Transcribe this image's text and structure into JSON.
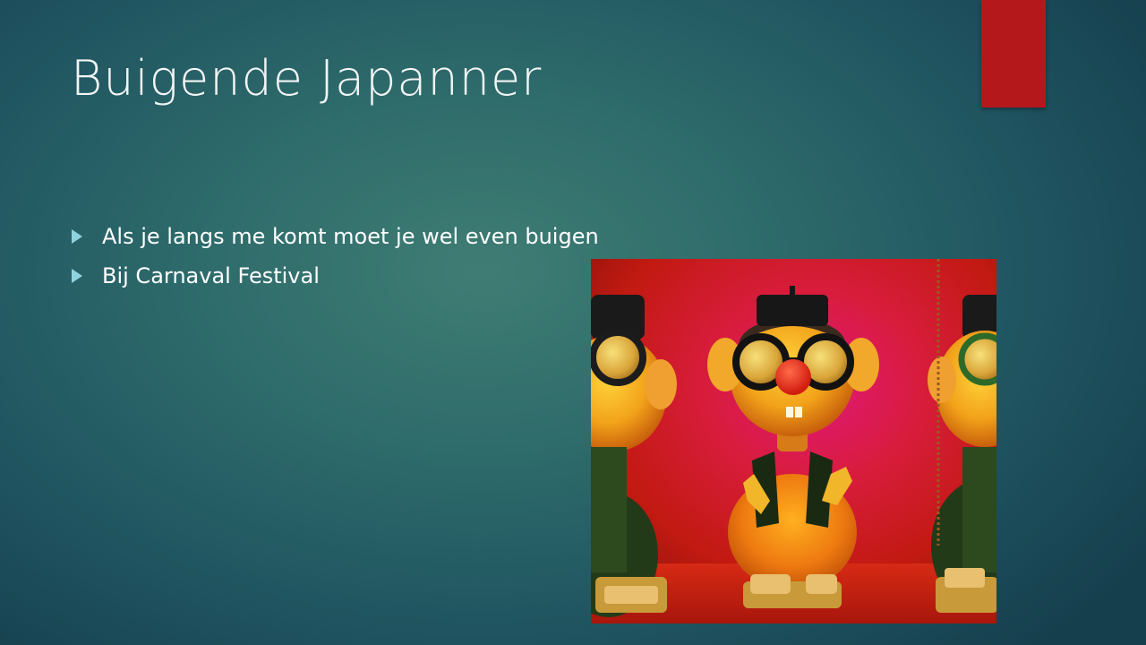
{
  "slide": {
    "title": "Buigende Japanner",
    "bullets": [
      "Als je langs me komt moet je wel even buigen",
      "Bij Carnaval Festival"
    ],
    "colors": {
      "accent": "#b5181b",
      "bullet": "#8fd3e0",
      "text": "#ffffff"
    }
  }
}
